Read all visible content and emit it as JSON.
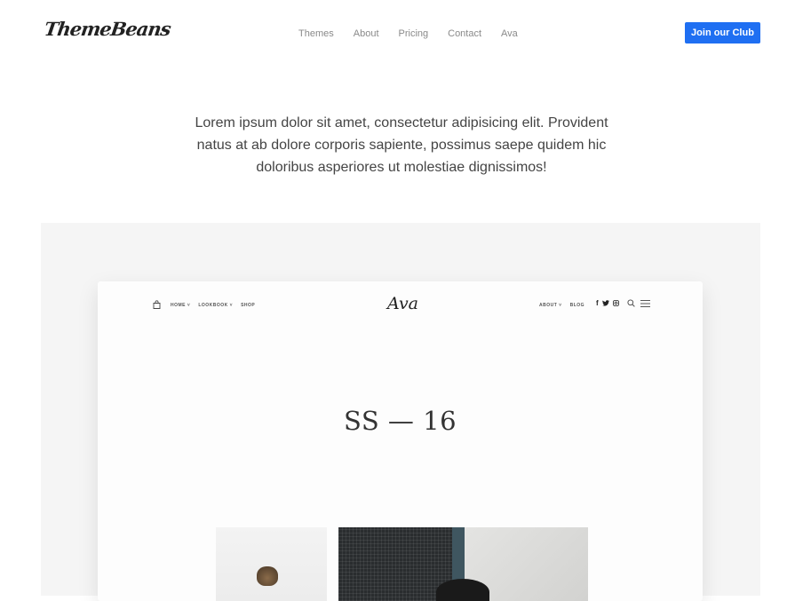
{
  "header": {
    "logo_text": "ThemeBeans",
    "nav": [
      "Themes",
      "About",
      "Pricing",
      "Contact",
      "Ava"
    ],
    "cta_label": "Join our Club"
  },
  "intro": {
    "text": "Lorem ipsum dolor sit amet, consectetur adipisicing elit. Provident natus at ab dolore corporis sapiente, possimus saepe quidem hic doloribus asperiores ut molestiae dignissimos!"
  },
  "preview": {
    "logo_text": "Ava",
    "nav_left": [
      "HOME ˅",
      "LOOKBOOK ˅",
      "SHOP"
    ],
    "nav_right": [
      "ABOUT ˅",
      "BLOG"
    ],
    "social_fb": "f",
    "hero_title": "SS — 16",
    "icons": [
      "shopping-bag-icon",
      "facebook-icon",
      "twitter-icon",
      "instagram-icon",
      "search-icon",
      "menu-icon"
    ]
  },
  "colors": {
    "accent": "#1f6ff2",
    "showcase_bg": "#f5f5f5"
  }
}
